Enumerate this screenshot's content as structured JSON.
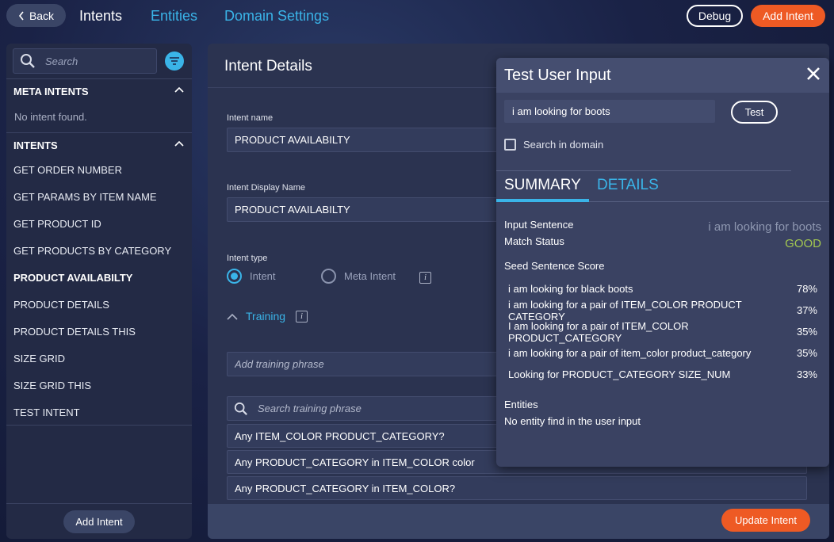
{
  "topbar": {
    "back_label": "Back",
    "nav": {
      "intents": "Intents",
      "entities": "Entities",
      "domain_settings": "Domain Settings"
    },
    "debug_label": "Debug",
    "add_intent_label": "Add Intent"
  },
  "sidebar": {
    "search_placeholder": "Search",
    "meta_intents_header": "META INTENTS",
    "meta_empty": "No intent found.",
    "intents_header": "INTENTS",
    "items": [
      {
        "label": "GET ORDER NUMBER"
      },
      {
        "label": "GET PARAMS BY ITEM NAME"
      },
      {
        "label": "GET PRODUCT ID"
      },
      {
        "label": "GET PRODUCTS BY CATEGORY"
      },
      {
        "label": "PRODUCT AVAILABILTY"
      },
      {
        "label": "PRODUCT DETAILS"
      },
      {
        "label": "PRODUCT DETAILS THIS"
      },
      {
        "label": "SIZE GRID"
      },
      {
        "label": "SIZE GRID THIS"
      },
      {
        "label": "TEST INTENT"
      }
    ],
    "add_intent_label": "Add Intent"
  },
  "main": {
    "title": "Intent Details",
    "intent_name_label": "Intent name",
    "intent_name_value": "PRODUCT AVAILABILTY",
    "display_name_label": "Intent Display Name",
    "display_name_value": "PRODUCT AVAILABILTY",
    "intent_type_label": "Intent type",
    "type_options": {
      "intent": "Intent",
      "meta": "Meta Intent"
    },
    "info_glyph": "i",
    "training_label": "Training",
    "add_phrase_placeholder": "Add training phrase",
    "search_phrase_placeholder": "Search training phrase",
    "phrases": [
      {
        "text": "Any ITEM_COLOR PRODUCT_CATEGORY?"
      },
      {
        "text": "Any PRODUCT_CATEGORY in ITEM_COLOR color"
      },
      {
        "text": "Any PRODUCT_CATEGORY in ITEM_COLOR?"
      }
    ],
    "update_label": "Update Intent"
  },
  "test_panel": {
    "title": "Test User Input",
    "input_value": "i am looking for boots",
    "test_label": "Test",
    "search_domain_label": "Search in domain",
    "tabs": {
      "summary": "SUMMARY",
      "details": "DETAILS"
    },
    "input_sentence_label": "Input Sentence",
    "input_sentence_value": "i am looking for boots",
    "match_status_label": "Match Status",
    "match_status_value": "GOOD",
    "seed_score_label": "Seed Sentence Score",
    "seeds": [
      {
        "sentence": "i am looking for black boots",
        "score": "78%"
      },
      {
        "sentence": "i am looking for a pair of ITEM_COLOR PRODUCT CATEGORY",
        "score": "37%"
      },
      {
        "sentence": "I am looking for a pair of ITEM_COLOR PRODUCT_CATEGORY",
        "score": "35%"
      },
      {
        "sentence": "i am looking for a pair of item_color product_category",
        "score": "35%"
      },
      {
        "sentence": "Looking for PRODUCT_CATEGORY SIZE_NUM",
        "score": "33%"
      }
    ],
    "entities_label": "Entities",
    "entities_value": "No entity find in the user input"
  },
  "colors": {
    "accent": "#3ab4e8",
    "primary_action": "#ee5a24",
    "good_status": "#a3c850"
  },
  "icons": [
    "chevron-left-icon",
    "search-icon",
    "filter-icon",
    "chevron-up-icon",
    "info-icon",
    "close-icon"
  ]
}
